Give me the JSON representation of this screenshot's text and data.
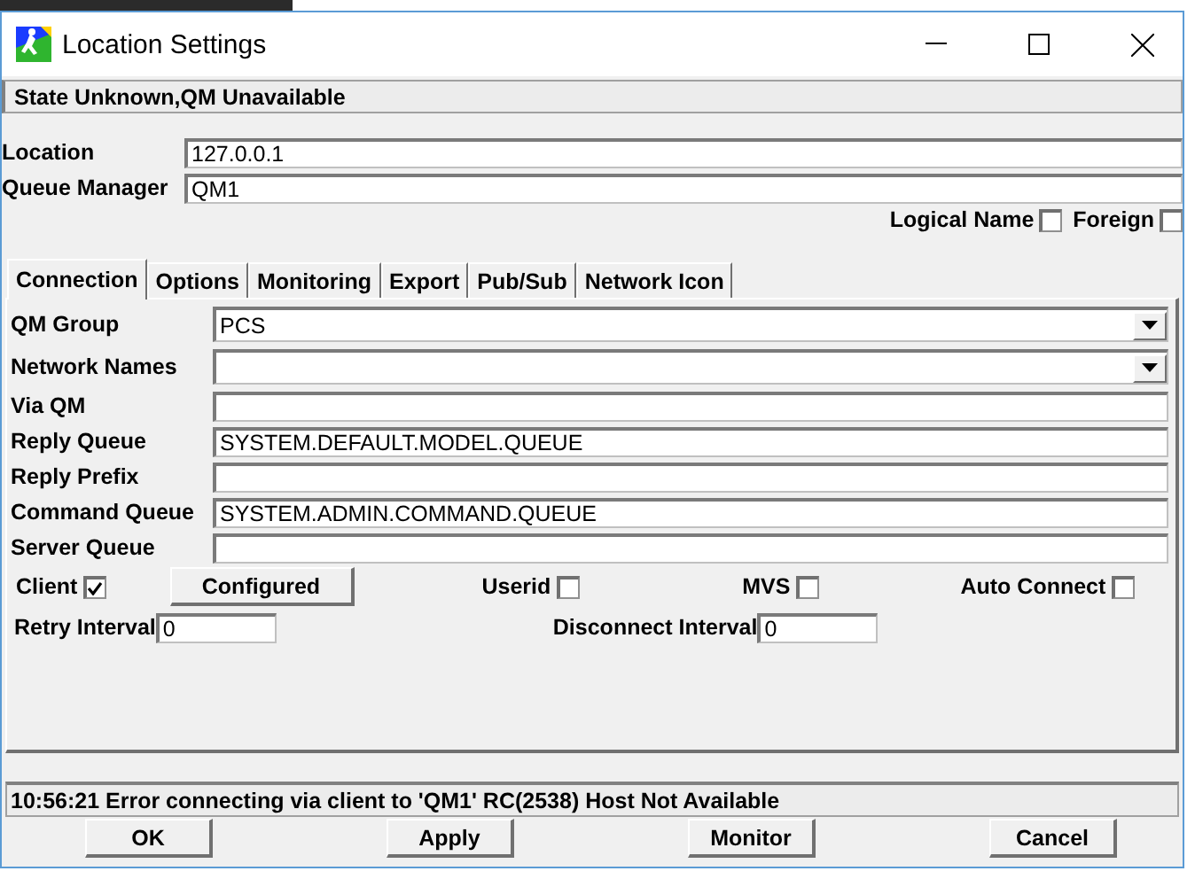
{
  "window": {
    "title": "Location Settings"
  },
  "status": "State Unknown,QM Unavailable",
  "top_fields": [
    {
      "label": "Location",
      "value": "127.0.0.1"
    },
    {
      "label": "Queue Manager",
      "value": "QM1"
    }
  ],
  "top_checks": [
    {
      "label": "Logical Name",
      "checked": false
    },
    {
      "label": "Foreign",
      "checked": false
    }
  ],
  "tabs": [
    {
      "label": "Connection",
      "selected": true
    },
    {
      "label": "Options",
      "selected": false
    },
    {
      "label": "Monitoring",
      "selected": false
    },
    {
      "label": "Export",
      "selected": false
    },
    {
      "label": "Pub/Sub",
      "selected": false
    },
    {
      "label": "Network Icon",
      "selected": false
    }
  ],
  "fields": [
    {
      "kind": "dropdown",
      "label": "QM Group",
      "value": "PCS"
    },
    {
      "kind": "dropdown",
      "label": "Network Names"
    },
    {
      "kind": "text",
      "label": "Via QM"
    },
    {
      "kind": "text",
      "label": "Reply Queue",
      "value": "SYSTEM.DEFAULT.MODEL.QUEUE"
    },
    {
      "kind": "text",
      "label": "Reply Prefix"
    },
    {
      "kind": "text",
      "label": "Command Queue",
      "value": "SYSTEM.ADMIN.COMMAND.QUEUE"
    },
    {
      "kind": "text",
      "label": "Server Queue"
    }
  ],
  "client": {
    "label": "Client",
    "checked": true
  },
  "configured_button": "Configured",
  "options": [
    {
      "label": "Userid",
      "checked": false
    },
    {
      "label": "MVS",
      "checked": false
    },
    {
      "label": "Auto Connect",
      "checked": false
    }
  ],
  "intervals": [
    {
      "label": "Retry Interval",
      "value": "0"
    },
    {
      "label": "Disconnect Interval",
      "value": "0"
    }
  ],
  "message": "10:56:21 Error connecting via client to 'QM1' RC(2538) Host Not Available",
  "buttons": [
    "OK",
    "Apply",
    "Monitor",
    "Cancel"
  ]
}
